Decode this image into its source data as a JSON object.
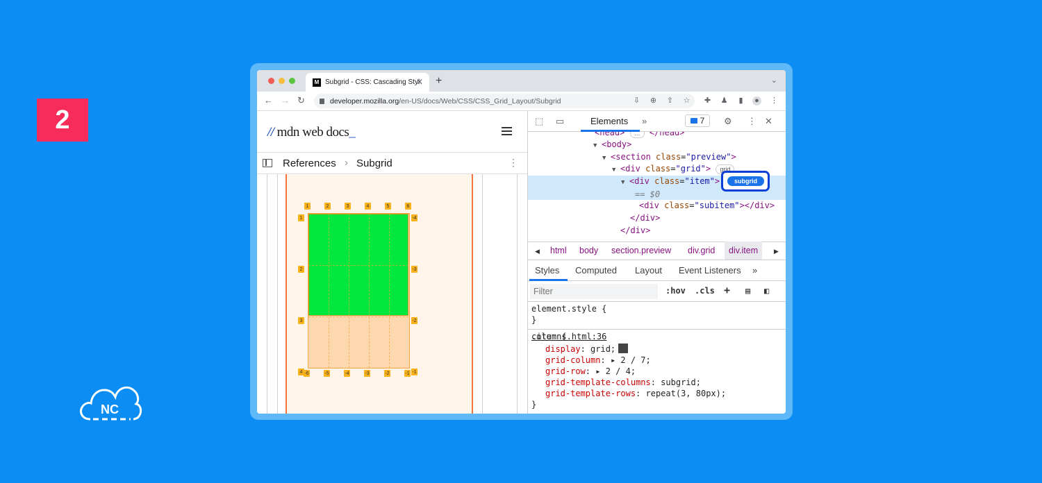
{
  "badge": "2",
  "brand": "NC",
  "browser": {
    "tab_title": "Subgrid - CSS: Cascading Styl",
    "tab_favicon": "M",
    "url_host": "developer.mozilla.org",
    "url_path": "/en-US/docs/Web/CSS/CSS_Grid_Layout/Subgrid"
  },
  "mdn": {
    "logo_mark": "//",
    "logo_text": "mdn web docs",
    "logo_underscore": "_",
    "crumb_1": "References",
    "crumb_sep": "›",
    "crumb_2": "Subgrid"
  },
  "grid_overlay": {
    "top_labels": [
      "1",
      "2",
      "3",
      "4",
      "5",
      "6"
    ],
    "bottom_labels": [
      "-6",
      "-5",
      "-4",
      "-3",
      "-2",
      "-1"
    ],
    "left_labels": [
      "1",
      "2",
      "3",
      "4"
    ],
    "right_labels": [
      "-4",
      "-3",
      "-2",
      "-1"
    ],
    "colors": {
      "green": "#00e83e",
      "orange_fill": "#fdd8ae",
      "label": "#f9b21c"
    }
  },
  "devtools": {
    "tab_elements": "Elements",
    "more": "»",
    "message_count": "7",
    "dom": {
      "head_line": "</head>",
      "body_open": "<body>",
      "section_tag": "section",
      "section_class": "\"preview\"",
      "grid_tag": "div",
      "grid_class": "\"grid\"",
      "grid_pill": "grid",
      "item_tag": "div",
      "item_class": "\"item\"",
      "subgrid_pill": "subgrid",
      "dollar_ref": "== $0",
      "subitem_class": "\"subitem\"",
      "div_close": "</div>",
      "div_close2": "</div>"
    },
    "breadcrumbs": [
      "html",
      "body",
      "section.preview",
      "div.grid",
      "div.item"
    ],
    "style_tabs": [
      "Styles",
      "Computed",
      "Layout",
      "Event Listeners",
      "»"
    ],
    "filter_placeholder": "Filter",
    "hov": ":hov",
    "cls": ".cls",
    "element_style": "element.style {",
    "close_brace": "}",
    "item_rule": {
      "selector": ".item {",
      "source": "columns.html:36",
      "props": [
        {
          "name": "display",
          "value": "grid;"
        },
        {
          "name": "grid-column",
          "value": "▸ 2 / 7;"
        },
        {
          "name": "grid-row",
          "value": "▸ 2 / 4;"
        },
        {
          "name": "grid-template-columns",
          "value": "subgrid;"
        },
        {
          "name": "grid-template-rows",
          "value": "repeat(3, 80px);"
        }
      ]
    }
  }
}
